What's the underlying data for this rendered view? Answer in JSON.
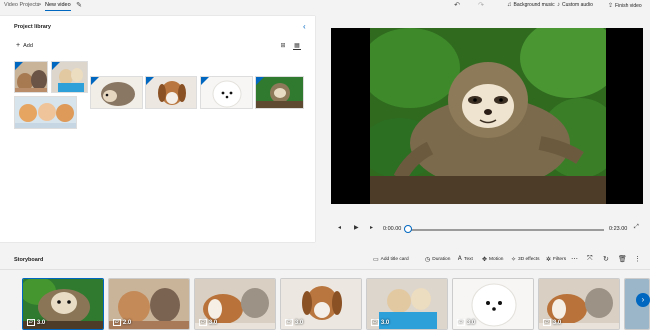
{
  "breadcrumb": {
    "root": "Video Projects",
    "separator": ">",
    "current": "New video"
  },
  "toolbar": {
    "background_music": "Background music",
    "custom_audio": "Custom audio",
    "finish_video": "Finish video"
  },
  "library": {
    "title": "Project library",
    "add_label": "Add",
    "thumbnails": [
      "cat-and-puppy",
      "puppies-in-basket",
      "hedgehog",
      "beagle-puppy",
      "white-puppy",
      "sloth",
      "kittens"
    ]
  },
  "player": {
    "current_time": "0:00.00",
    "total_time": "0:23.00",
    "progress": 0.0
  },
  "storyboard": {
    "title": "Storyboard",
    "tools": {
      "add_title_card": "Add title card",
      "duration": "Duration",
      "text": "Text",
      "motion": "Motion",
      "effects_3d": "3D effects",
      "filters": "Filters"
    },
    "cards": [
      {
        "subject": "sloth",
        "duration": "3.0"
      },
      {
        "subject": "cat-and-puppy",
        "duration": "2.0"
      },
      {
        "subject": "guinea-pig-and-kitten",
        "duration": "3.0"
      },
      {
        "subject": "beagle-puppy",
        "duration": "3.0"
      },
      {
        "subject": "puppies-in-basket",
        "duration": "3.0"
      },
      {
        "subject": "white-puppy",
        "duration": "3.0"
      },
      {
        "subject": "guinea-pig-and-kitten",
        "duration": "3.0"
      }
    ]
  },
  "colors": {
    "accent": "#0067c0",
    "panel": "#ffffff",
    "background": "#f3f3f3"
  }
}
